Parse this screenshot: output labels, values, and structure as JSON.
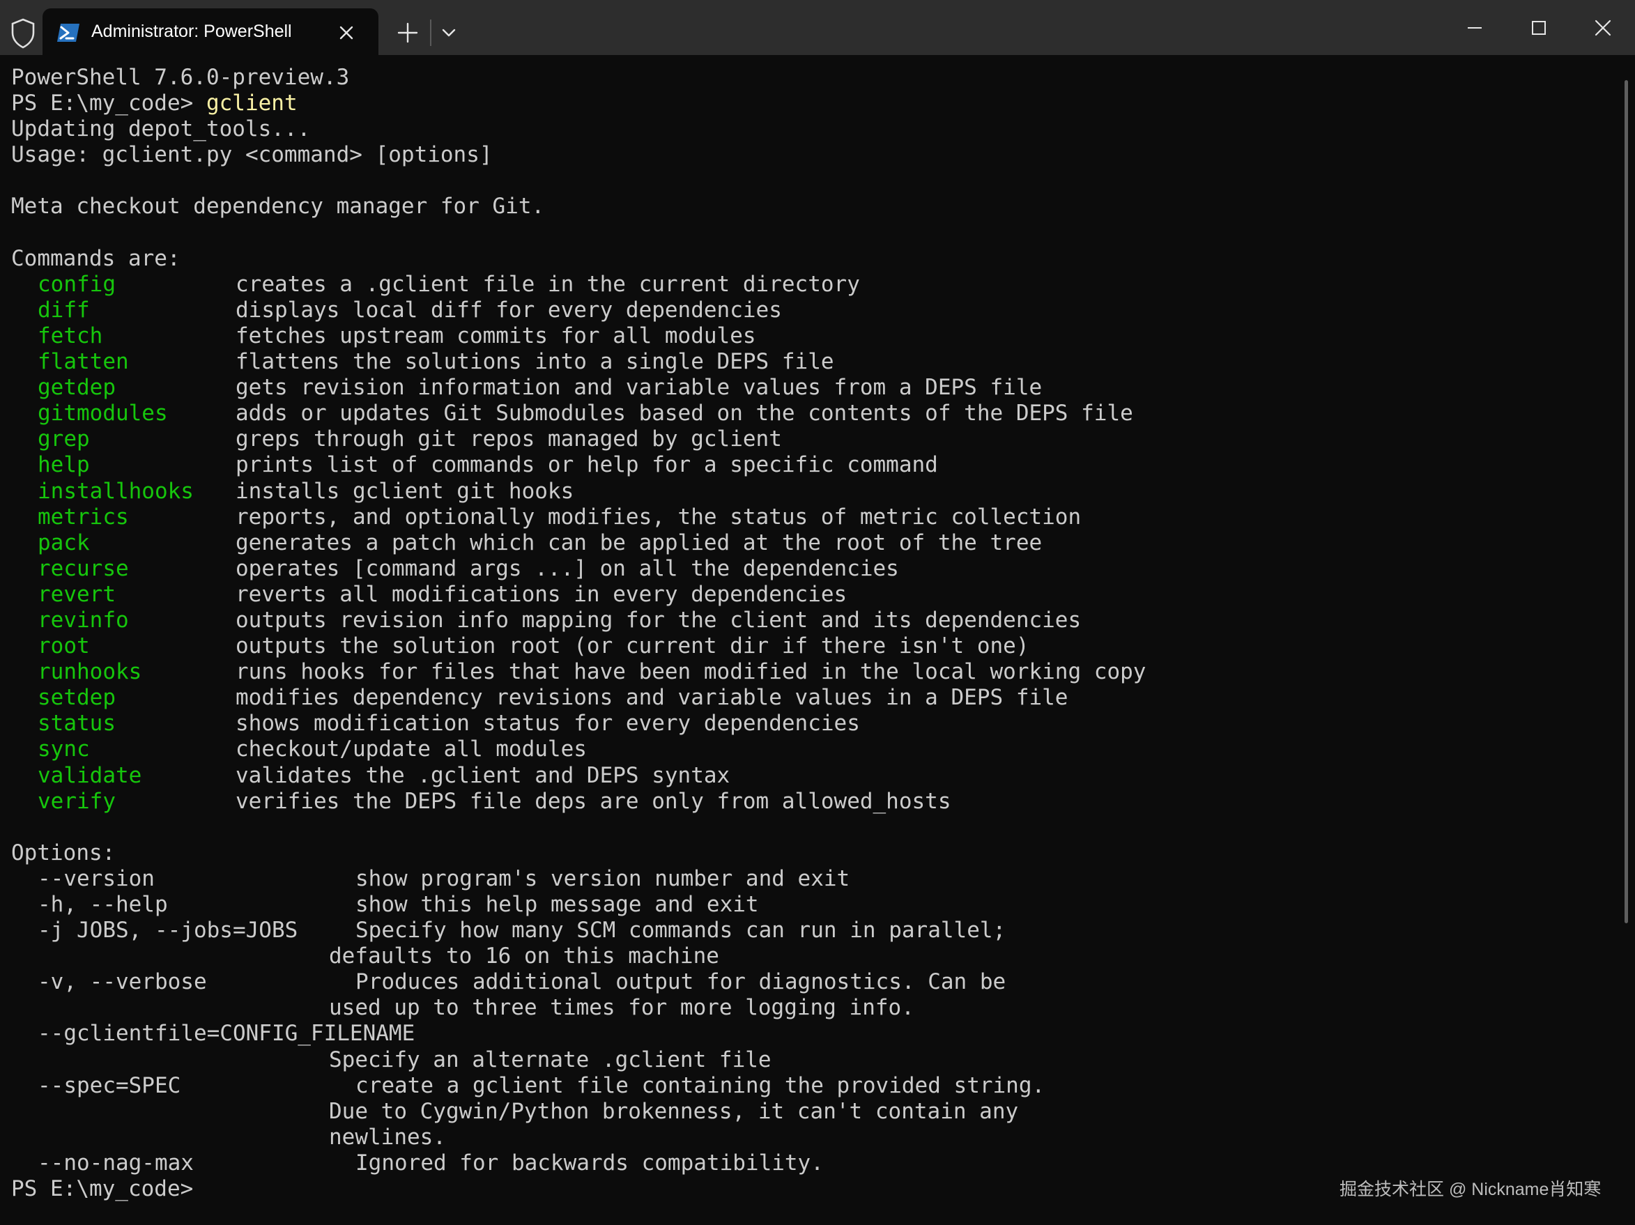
{
  "window": {
    "tab_title": "Administrator: PowerShell",
    "icons": {
      "shield": "shield-icon",
      "tab": "powershell-icon",
      "close_tab": "close-icon",
      "new_tab": "plus-icon",
      "dropdown": "chevron-down-icon",
      "minimize": "minimize-icon",
      "maximize": "maximize-icon",
      "close_window": "close-icon"
    }
  },
  "colors": {
    "background": "#0c0c0c",
    "titlebar": "#2d2d2d",
    "foreground": "#cccccc",
    "command_highlight": "#16c60c",
    "typed_input": "#f9f1a5"
  },
  "terminal": {
    "version_line": "PowerShell 7.6.0-preview.3",
    "prompt": "PS E:\\my_code> ",
    "typed_command": "gclient",
    "updating_line": "Updating depot_tools...",
    "usage_line": "Usage: gclient.py <command> [options]",
    "description_line": "Meta checkout dependency manager for Git.",
    "commands_header": "Commands are:",
    "commands": [
      {
        "name": "config",
        "desc": "creates a .gclient file in the current directory"
      },
      {
        "name": "diff",
        "desc": "displays local diff for every dependencies"
      },
      {
        "name": "fetch",
        "desc": "fetches upstream commits for all modules"
      },
      {
        "name": "flatten",
        "desc": "flattens the solutions into a single DEPS file"
      },
      {
        "name": "getdep",
        "desc": "gets revision information and variable values from a DEPS file"
      },
      {
        "name": "gitmodules",
        "desc": "adds or updates Git Submodules based on the contents of the DEPS file"
      },
      {
        "name": "grep",
        "desc": "greps through git repos managed by gclient"
      },
      {
        "name": "help",
        "desc": "prints list of commands or help for a specific command"
      },
      {
        "name": "installhooks",
        "desc": "installs gclient git hooks"
      },
      {
        "name": "metrics",
        "desc": "reports, and optionally modifies, the status of metric collection"
      },
      {
        "name": "pack",
        "desc": "generates a patch which can be applied at the root of the tree"
      },
      {
        "name": "recurse",
        "desc": "operates [command args ...] on all the dependencies"
      },
      {
        "name": "revert",
        "desc": "reverts all modifications in every dependencies"
      },
      {
        "name": "revinfo",
        "desc": "outputs revision info mapping for the client and its dependencies"
      },
      {
        "name": "root",
        "desc": "outputs the solution root (or current dir if there isn't one)"
      },
      {
        "name": "runhooks",
        "desc": "runs hooks for files that have been modified in the local working copy"
      },
      {
        "name": "setdep",
        "desc": "modifies dependency revisions and variable values in a DEPS file"
      },
      {
        "name": "status",
        "desc": "shows modification status for every dependencies"
      },
      {
        "name": "sync",
        "desc": "checkout/update all modules"
      },
      {
        "name": "validate",
        "desc": "validates the .gclient and DEPS syntax"
      },
      {
        "name": "verify",
        "desc": "verifies the DEPS file deps are only from allowed_hosts"
      }
    ],
    "options_header": "Options:",
    "options": [
      {
        "flag": "--version",
        "desc": [
          "show program's version number and exit"
        ]
      },
      {
        "flag": "-h, --help",
        "desc": [
          "show this help message and exit"
        ]
      },
      {
        "flag": "-j JOBS, --jobs=JOBS",
        "desc": [
          "Specify how many SCM commands can run in parallel;",
          "defaults to 16 on this machine"
        ]
      },
      {
        "flag": "-v, --verbose",
        "desc": [
          "Produces additional output for diagnostics. Can be",
          "used up to three times for more logging info."
        ]
      },
      {
        "flag": "--gclientfile=CONFIG_FILENAME",
        "desc": [
          "",
          "Specify an alternate .gclient file"
        ]
      },
      {
        "flag": "--spec=SPEC",
        "desc": [
          "create a gclient file containing the provided string.",
          "Due to Cygwin/Python brokenness, it can't contain any",
          "newlines."
        ]
      },
      {
        "flag": "--no-nag-max",
        "desc": [
          "Ignored for backwards compatibility."
        ]
      }
    ],
    "final_prompt": "PS E:\\my_code>"
  },
  "watermark": "掘金技术社区 @ Nickname肖知寒"
}
